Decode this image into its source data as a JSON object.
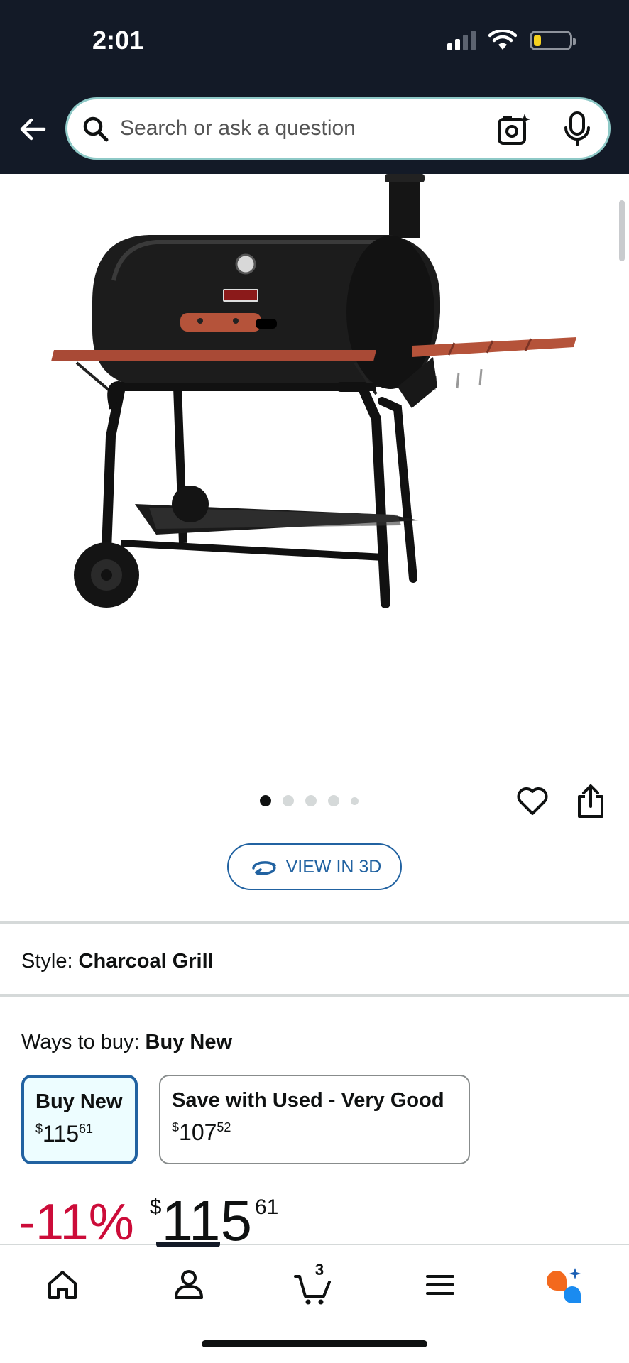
{
  "status_bar": {
    "time": "2:01",
    "battery_color": "#f6d21f"
  },
  "header": {
    "search_placeholder": "Search or ask a question",
    "icons": [
      "back-arrow-icon",
      "search-icon",
      "camera-search-icon",
      "microphone-icon"
    ]
  },
  "gallery": {
    "image_count": 5,
    "active_index": 0,
    "view_3d_label": "VIEW IN 3D"
  },
  "style": {
    "label": "Style:",
    "value": "Charcoal Grill"
  },
  "ways_to_buy": {
    "label": "Ways to buy:",
    "value": "Buy New",
    "options": [
      {
        "title": "Buy New",
        "currency": "$",
        "whole": "115",
        "fraction": "61",
        "selected": true
      },
      {
        "title": "Save with Used - Very Good",
        "currency": "$",
        "whole": "107",
        "fraction": "52",
        "selected": false
      }
    ]
  },
  "price": {
    "discount": "-11%",
    "currency": "$",
    "whole": "115",
    "fraction": "61",
    "discount_color": "#cc0c39"
  },
  "bottom_nav": {
    "cart_count": "3",
    "items": [
      "home-icon",
      "account-icon",
      "cart-icon",
      "menu-icon",
      "rufus-ai-icon"
    ]
  },
  "colors": {
    "header_bg": "#131a27",
    "link_blue": "#2162a1",
    "search_border": "#8ec9c7"
  }
}
